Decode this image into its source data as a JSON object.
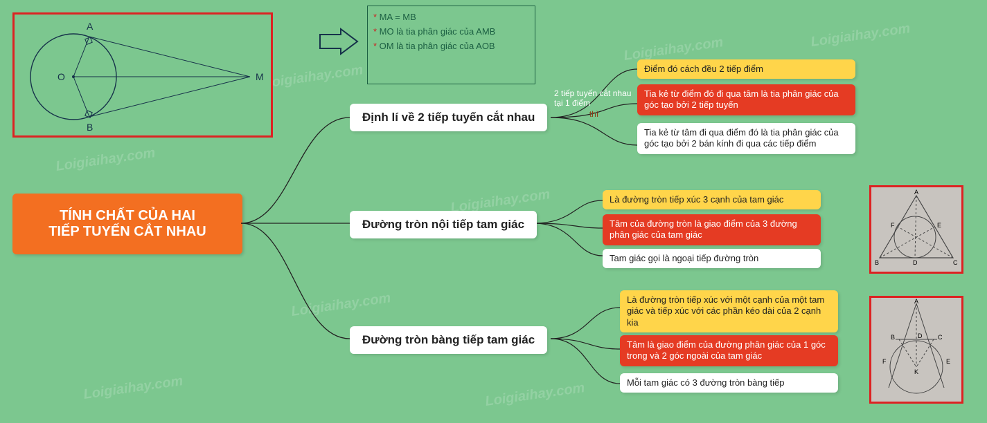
{
  "root": {
    "title": "TÍNH CHẤT CỦA HAI\nTIẾP TUYẾN CẮT NHAU"
  },
  "branch1": {
    "label": "Định lí về 2 tiếp tuyến cắt nhau",
    "link": "2 tiếp tuyến cắt nhau tại 1 điểm",
    "link_then": "thì",
    "leaves": [
      "Điểm đó cách đều 2 tiếp điểm",
      "Tia kẻ từ điểm đó đi qua tâm là tia phân giác của góc tạo bởi 2 tiếp tuyến",
      "Tia kẻ từ tâm đi qua điểm đó là tia phân giác của góc tạo bởi 2 bán kính đi qua các tiếp điểm"
    ]
  },
  "branch2": {
    "label": "Đường tròn nội tiếp tam giác",
    "leaves": [
      "Là đường tròn tiếp xúc 3 cạnh của tam giác",
      "Tâm của đường tròn là giao điểm của 3 đường phân giác của tam giác",
      "Tam giác gọi là ngoại tiếp đường tròn"
    ]
  },
  "branch3": {
    "label": "Đường tròn bàng tiếp tam giác",
    "leaves": [
      "Là đường tròn tiếp xúc với một cạnh của một tam giác và tiếp xúc với các phần kéo dài của 2 cạnh kia",
      "Tâm là giao điểm của đường phân giác của 1 góc trong và 2 góc ngoài của tam giác",
      "Mỗi tam giác có 3 đường tròn bàng tiếp"
    ]
  },
  "theorem": {
    "l1": "MA = MB",
    "l2": "MO là tia phân giác của AMB",
    "l3": "OM là tia phân giác của AOB"
  },
  "topfig_labels": {
    "A": "A",
    "B": "B",
    "O": "O",
    "M": "M"
  },
  "fig2_labels": {
    "A": "A",
    "B": "B",
    "C": "C",
    "D": "D",
    "E": "E",
    "F": "F"
  },
  "fig3_labels": {
    "A": "A",
    "B": "B",
    "C": "C",
    "D": "D",
    "E": "E",
    "F": "F",
    "K": "K"
  },
  "watermark": "Loigiaihay.com"
}
